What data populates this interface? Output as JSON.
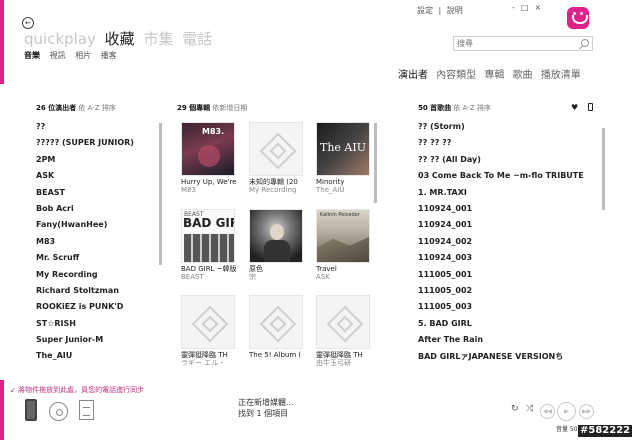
{
  "app": {
    "pivots": [
      "quickplay",
      "收藏",
      "市集",
      "電話"
    ],
    "active_pivot": 1,
    "subnav": [
      "音樂",
      "視訊",
      "相片",
      "播客"
    ],
    "active_subnav": 0,
    "top_links": [
      "設定",
      "說明"
    ],
    "window_controls": [
      "-",
      "□",
      "×"
    ]
  },
  "search": {
    "placeholder": "搜尋",
    "value": "搜尋"
  },
  "view_tabs": [
    "演出者",
    "內容類型",
    "專輯",
    "歌曲",
    "播放清單"
  ],
  "artists": {
    "count_label": "26 位演出者",
    "sort_label": "依 A-Z 排序",
    "items": [
      "??",
      "????? (SUPER JUNIOR)",
      "2PM",
      "ASK",
      "BEAST",
      "Bob Acri",
      "Fany(HwanHee)",
      "M83",
      "Mr. Scruff",
      "My Recording",
      "Richard Stoltzman",
      "ROOKiEZ is PUNK'D",
      "ST☆RISH",
      "Super Junior-M",
      "The_AIU"
    ]
  },
  "albums": {
    "count_label": "29 個專輯",
    "sort_label": "依新增日期",
    "items": [
      {
        "title": "Hurry Up, We're",
        "artist": "M83",
        "art": "m83"
      },
      {
        "title": "未知的專輯 (20",
        "artist": "My Recording",
        "art": "none"
      },
      {
        "title": "Minority",
        "artist": "The_AIU",
        "art": "aiu"
      },
      {
        "title": "BAD GIRL ~韓版",
        "artist": "BEAST",
        "art": "beast"
      },
      {
        "title": "原色",
        "artist": "宗",
        "art": "man"
      },
      {
        "title": "Travel",
        "artist": "ASK",
        "art": "travel"
      },
      {
        "title": "靈彈挺降臨 TH",
        "artist": "ラギー エル・",
        "art": "none"
      },
      {
        "title": "The 5! Album (",
        "artist": "",
        "art": "none"
      },
      {
        "title": "靈彈挺降臨 TH",
        "artist": "由牛玉弓研",
        "art": "none"
      }
    ],
    "art_labels": {
      "m83": "M83.",
      "aiu": "The AIU",
      "beast_small": "BEAST",
      "beast_big": "BAD GIRL",
      "travel": "Kalinin Peicedor"
    }
  },
  "songs": {
    "count_label": "50 首歌曲",
    "sort_label": "依 A-Z 排序",
    "items": [
      "?? (Storm)",
      "?? ?? ??",
      "?? ?? (All Day)",
      "03  Come Back To Me ~m-flo TRIBUTE",
      "1. MR.TAXI",
      "110924_001",
      "110924_001",
      "110924_002",
      "110924_003",
      "111005_001",
      "111005_002",
      "111005_003",
      "5. BAD GIRL",
      "After The Rain",
      "BAD GIRLァJAPANESE VERSIONち"
    ]
  },
  "footer": {
    "sync_notice": "將物件拖放到此處，員您的電話進行同步",
    "status_line1": "正在新增媒體...",
    "status_line2": "找到 1 個項目",
    "volume_label": "音量 50",
    "watermark": "#582222"
  }
}
